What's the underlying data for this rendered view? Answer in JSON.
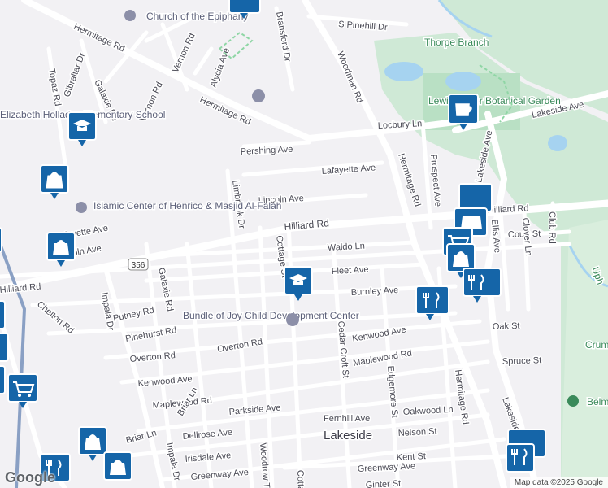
{
  "map": {
    "roads": [
      "Hermitage Rd",
      "Hilliard Rd",
      "Lakeside Ave",
      "Woodman Rd",
      "Lincoln Ave",
      "Lafayette Ave",
      "Pershing Ave",
      "Locbury Ln",
      "Waldo Ln",
      "Fleet Ave",
      "Burnley Ave",
      "Kenwood Ave",
      "Overton Rd",
      "Maplewood Rd",
      "Spruce St",
      "Oak St",
      "Court St",
      "Parkside Ave",
      "Fernhill Ave",
      "Oakwood Ln",
      "Nelson St",
      "Kent St",
      "Greenway Ave",
      "Dellrose Ave",
      "Irisdale Ave",
      "Briar Ln",
      "Impala Dr",
      "Galaxie Rd",
      "Vernon Rd",
      "Gibraltar Dr",
      "Topaz Rd",
      "Alycia Ave",
      "Bransford Dr",
      "Limbrook Dr",
      "Cottage St",
      "Cedar Croft St",
      "Edgemore St",
      "Prospect Ave",
      "Ellis Ave",
      "Clover Ln",
      "Club Rd",
      "Putney Rd",
      "Pinehurst Rd",
      "Chelton Rd",
      "Woodrow T",
      "S Pinehill Dr",
      "Ginter St",
      "356"
    ],
    "pois": {
      "church": "Church of the Epiphany",
      "school1": "Elizabeth Holladay Elementary School",
      "islamic": "Islamic Center of Henrico & Masjid Al-Falah",
      "daycare": "Bundle of Joy Child Development Center",
      "garden": "Lewis Ginter Botanical Garden",
      "branch": "Thorpe Branch",
      "belm": "Belm",
      "uph": "Uph",
      "crum": "Crum"
    },
    "town": "Lakeside",
    "attribution": "Map data ©2025 Google",
    "logo": "Google"
  }
}
